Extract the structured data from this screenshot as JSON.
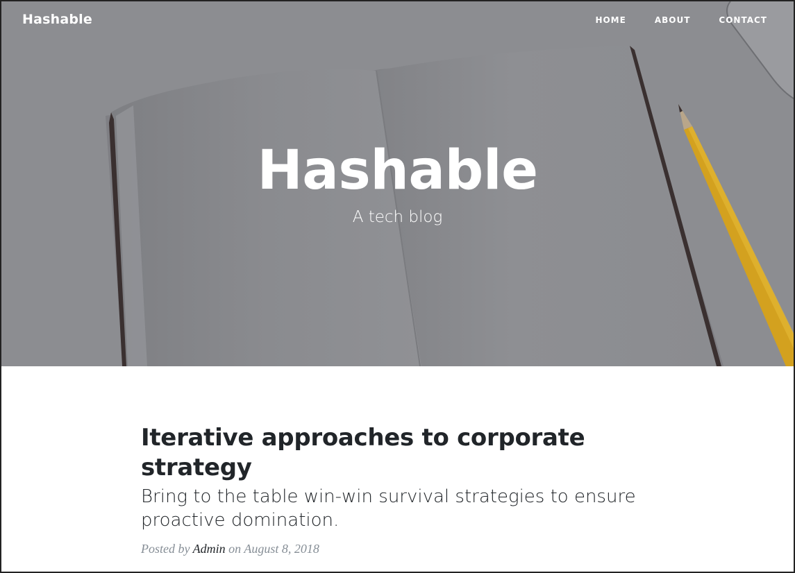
{
  "navbar": {
    "brand": "Hashable",
    "links": [
      {
        "label": "HOME"
      },
      {
        "label": "ABOUT"
      },
      {
        "label": "CONTACT"
      }
    ]
  },
  "masthead": {
    "title": "Hashable",
    "subtitle": "A tech blog"
  },
  "post": {
    "title": "Iterative approaches to corporate strategy",
    "subtitle": "Bring to the table win-win survival strategies to ensure proactive domination.",
    "meta_prefix": "Posted by",
    "author": "Admin",
    "meta_on": "on",
    "date": "August 8, 2018"
  },
  "colors": {
    "overlay": "#8a8b8f",
    "text_dark": "#212529",
    "meta_gray": "#868e96",
    "pencil": "#d9a21c"
  }
}
